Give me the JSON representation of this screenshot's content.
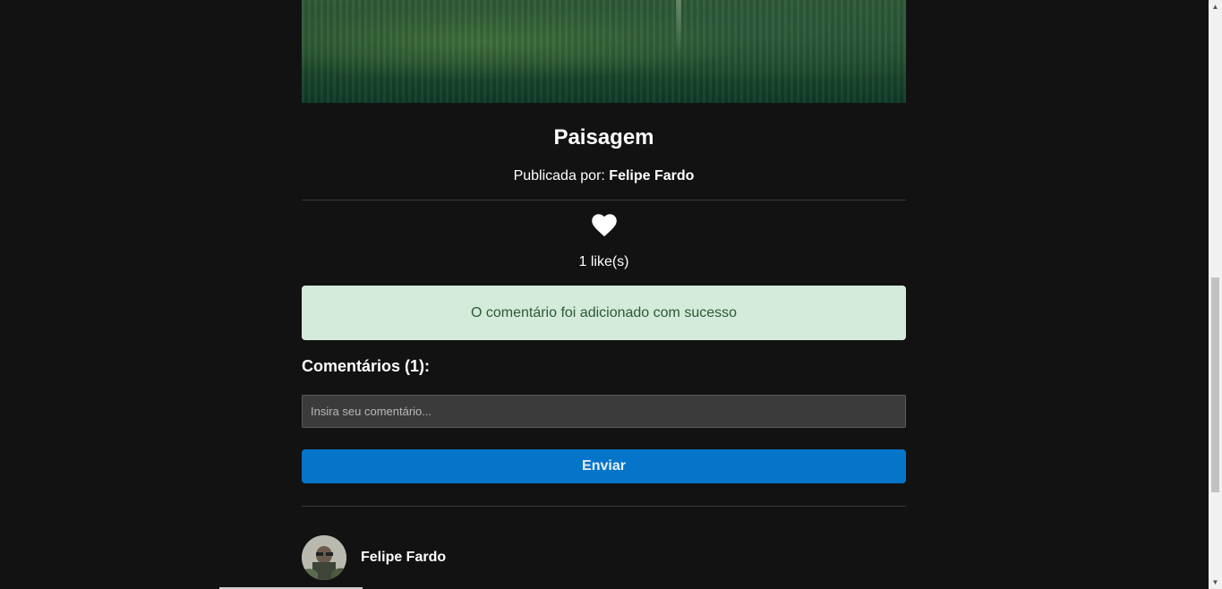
{
  "post": {
    "title": "Paisagem",
    "author_prefix": "Publicada por: ",
    "author_name": "Felipe Fardo",
    "likes_text": "1 like(s)"
  },
  "alert": {
    "message": "O comentário foi adicionado com sucesso",
    "background_color": "#d4eadb",
    "text_color": "#2b5a34"
  },
  "comments": {
    "heading": "Comentários (1):",
    "input_placeholder": "Insira seu comentário...",
    "send_label": "Enviar",
    "send_color": "#0575c9",
    "items": [
      {
        "author": "Felipe Fardo"
      }
    ]
  },
  "icons": {
    "like": "heart-icon",
    "scroll_up": "chevron-up-icon",
    "scroll_down": "chevron-down-icon"
  },
  "theme": {
    "background": "#121212"
  }
}
